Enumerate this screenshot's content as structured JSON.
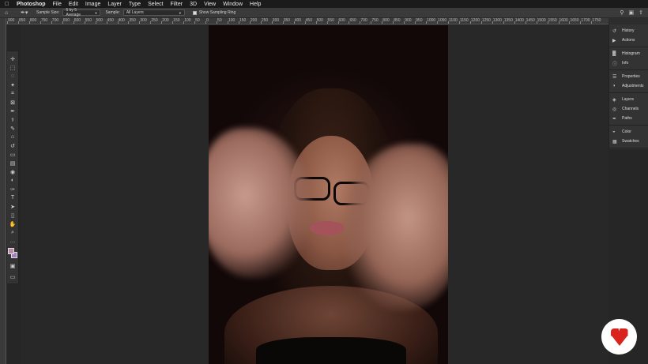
{
  "menubar": {
    "app_name": "Photoshop",
    "items": [
      "File",
      "Edit",
      "Image",
      "Layer",
      "Type",
      "Select",
      "Filter",
      "3D",
      "View",
      "Window",
      "Help"
    ]
  },
  "options": {
    "sample_size_label": "Sample Size:",
    "sample_size_value": "5 by 5 Average",
    "sample_label": "Sample:",
    "sample_value": "All Layers",
    "show_ring_label": "Show Sampling Ring",
    "show_ring_checked": true
  },
  "ruler": {
    "labels": [
      "900",
      "850",
      "800",
      "750",
      "700",
      "650",
      "600",
      "550",
      "500",
      "450",
      "400",
      "350",
      "300",
      "250",
      "200",
      "150",
      "100",
      "50",
      "0",
      "50",
      "100",
      "150",
      "200",
      "250",
      "300",
      "350",
      "400",
      "450",
      "500",
      "550",
      "600",
      "650",
      "700",
      "750",
      "800",
      "850",
      "900",
      "950",
      "1000",
      "1050",
      "1100",
      "1150",
      "1200",
      "1250",
      "1300",
      "1350",
      "1400",
      "1450",
      "1500",
      "1550",
      "1600",
      "1650",
      "1700",
      "1750"
    ]
  },
  "tools": [
    "move-icon",
    "marquee-icon",
    "lasso-icon",
    "quick-select-icon",
    "crop-icon",
    "frame-icon",
    "eyedropper-icon",
    "healing-icon",
    "brush-icon",
    "clone-stamp-icon",
    "history-brush-icon",
    "eraser-icon",
    "gradient-icon",
    "blur-icon",
    "dodge-icon",
    "pen-icon",
    "type-icon",
    "path-select-icon",
    "rectangle-icon",
    "hand-icon",
    "zoom-icon",
    "more-tools-icon"
  ],
  "colors": {
    "foreground": "#b88aa8",
    "background": "#a07cc0"
  },
  "panels": [
    {
      "items": [
        {
          "label": "History",
          "icon": "history-icon"
        },
        {
          "label": "Actions",
          "icon": "actions-icon"
        }
      ]
    },
    {
      "items": [
        {
          "label": "Histogram",
          "icon": "histogram-icon"
        },
        {
          "label": "Info",
          "icon": "info-icon"
        }
      ]
    },
    {
      "items": [
        {
          "label": "Properties",
          "icon": "properties-icon"
        },
        {
          "label": "Adjustments",
          "icon": "adjustments-icon"
        }
      ]
    },
    {
      "items": [
        {
          "label": "Layers",
          "icon": "layers-icon"
        },
        {
          "label": "Channels",
          "icon": "channels-icon"
        },
        {
          "label": "Paths",
          "icon": "paths-icon"
        }
      ]
    },
    {
      "items": [
        {
          "label": "Color",
          "icon": "color-icon"
        },
        {
          "label": "Swatches",
          "icon": "swatches-icon"
        }
      ]
    }
  ]
}
